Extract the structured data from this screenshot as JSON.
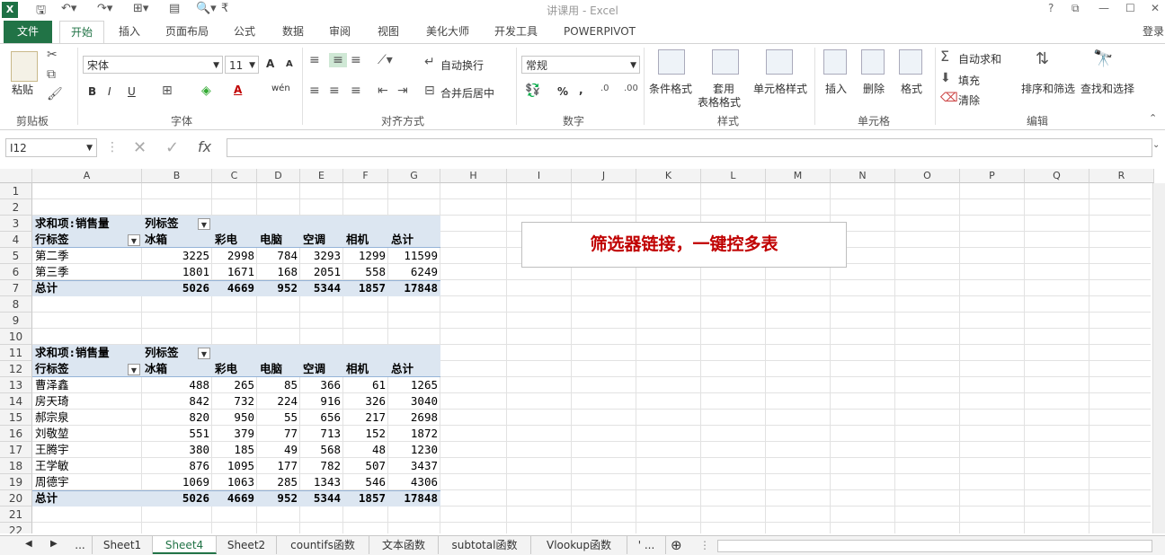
{
  "window": {
    "title": "讲课用 - Excel",
    "app_icon": "X",
    "controls": [
      "?",
      "⧉",
      "—",
      "☐",
      "✕"
    ]
  },
  "quick_access": [
    "save-icon",
    "undo-icon",
    "redo-icon",
    "customize-icon"
  ],
  "tabs": [
    {
      "label": "文件"
    },
    {
      "label": "开始"
    },
    {
      "label": "插入"
    },
    {
      "label": "页面布局"
    },
    {
      "label": "公式"
    },
    {
      "label": "数据"
    },
    {
      "label": "审阅"
    },
    {
      "label": "视图"
    },
    {
      "label": "美化大师"
    },
    {
      "label": "开发工具"
    },
    {
      "label": "POWERPIVOT"
    }
  ],
  "active_tab": "开始",
  "login_label": "登录",
  "ribbon": {
    "clipboard": {
      "group": "剪贴板",
      "paste": "粘贴"
    },
    "font": {
      "group": "字体",
      "font_name": "宋体",
      "font_size": "11",
      "bold": "B",
      "italic": "I",
      "underline": "U",
      "grow": "A",
      "shrink": "A",
      "font_color": "A",
      "phonetic": "wén"
    },
    "alignment": {
      "group": "对齐方式",
      "wrap": "自动换行",
      "merge": "合并后居中"
    },
    "number": {
      "group": "数字",
      "format": "常规",
      "percent": "%",
      "comma": ","
    },
    "styles": {
      "group": "样式",
      "conditional": "条件格式",
      "table1": "套用",
      "table2": "表格格式",
      "cell_styles": "单元格样式"
    },
    "cells": {
      "group": "单元格",
      "insert": "插入",
      "delete": "删除",
      "format": "格式"
    },
    "editing": {
      "group": "编辑",
      "autosum": "自动求和",
      "fill": "填充",
      "clear": "清除",
      "sort": "排序和筛选",
      "find": "查找和选择"
    }
  },
  "formula_bar": {
    "name_box": "I12",
    "fx": "fx",
    "content": ""
  },
  "columns": [
    "A",
    "B",
    "C",
    "D",
    "E",
    "F",
    "G",
    "H",
    "I",
    "J",
    "K",
    "L",
    "M",
    "N",
    "O",
    "P",
    "Q",
    "R"
  ],
  "rows": [
    "1",
    "2",
    "3",
    "4",
    "5",
    "6",
    "7",
    "8",
    "9",
    "10",
    "11",
    "12",
    "13",
    "14",
    "15",
    "16",
    "17",
    "18",
    "19",
    "20",
    "21",
    "22"
  ],
  "pivot1": {
    "value_label": "求和项:销售量",
    "col_label": "列标签",
    "row_label": "行标签",
    "headers": [
      "冰箱",
      "彩电",
      "电脑",
      "空调",
      "相机",
      "总计"
    ],
    "rows": [
      {
        "name": "第二季",
        "values": [
          "3225",
          "2998",
          "784",
          "3293",
          "1299",
          "11599"
        ]
      },
      {
        "name": "第三季",
        "values": [
          "1801",
          "1671",
          "168",
          "2051",
          "558",
          "6249"
        ]
      }
    ],
    "total": {
      "name": "总计",
      "values": [
        "5026",
        "4669",
        "952",
        "5344",
        "1857",
        "17848"
      ]
    }
  },
  "pivot2": {
    "value_label": "求和项:销售量",
    "col_label": "列标签",
    "row_label": "行标签",
    "headers": [
      "冰箱",
      "彩电",
      "电脑",
      "空调",
      "相机",
      "总计"
    ],
    "rows": [
      {
        "name": "曹泽鑫",
        "values": [
          "488",
          "265",
          "85",
          "366",
          "61",
          "1265"
        ]
      },
      {
        "name": "房天琦",
        "values": [
          "842",
          "732",
          "224",
          "916",
          "326",
          "3040"
        ]
      },
      {
        "name": "郝宗泉",
        "values": [
          "820",
          "950",
          "55",
          "656",
          "217",
          "2698"
        ]
      },
      {
        "name": "刘敬堃",
        "values": [
          "551",
          "379",
          "77",
          "713",
          "152",
          "1872"
        ]
      },
      {
        "name": "王腾宇",
        "values": [
          "380",
          "185",
          "49",
          "568",
          "48",
          "1230"
        ]
      },
      {
        "name": "王学敏",
        "values": [
          "876",
          "1095",
          "177",
          "782",
          "507",
          "3437"
        ]
      },
      {
        "name": "周德宇",
        "values": [
          "1069",
          "1063",
          "285",
          "1343",
          "546",
          "4306"
        ]
      }
    ],
    "total": {
      "name": "总计",
      "values": [
        "5026",
        "4669",
        "952",
        "5344",
        "1857",
        "17848"
      ]
    }
  },
  "callout": "筛选器链接，一键控多表",
  "sheet_tabs": [
    "...",
    "Sheet1",
    "Sheet4",
    "Sheet2",
    "countifs函数",
    "文本函数",
    "subtotal函数",
    "Vlookup函数",
    "' ..."
  ],
  "active_sheet": "Sheet4"
}
